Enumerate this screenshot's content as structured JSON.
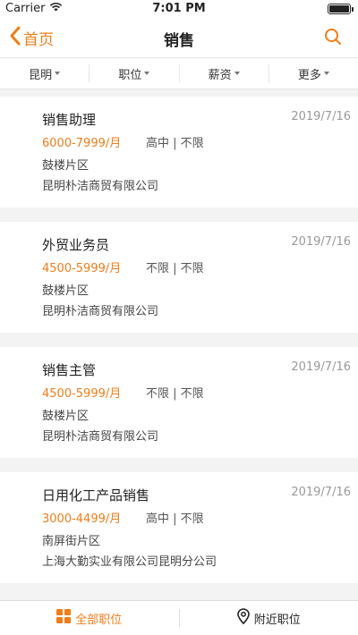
{
  "status": {
    "carrier": "Carrier",
    "time": "7:01 PM"
  },
  "nav": {
    "back_label": "首页",
    "title": "销售"
  },
  "filters": [
    {
      "label": "昆明"
    },
    {
      "label": "职位"
    },
    {
      "label": "薪资"
    },
    {
      "label": "更多"
    }
  ],
  "jobs": [
    {
      "title": "销售助理",
      "date": "2019/7/16",
      "salary": "6000-7999/月",
      "requirement": "高中 | 不限",
      "area": "鼓楼片区",
      "company": "昆明朴洁商贸有限公司"
    },
    {
      "title": "外贸业务员",
      "date": "2019/7/16",
      "salary": "4500-5999/月",
      "requirement": "不限 | 不限",
      "area": "鼓楼片区",
      "company": "昆明朴洁商贸有限公司"
    },
    {
      "title": "销售主管",
      "date": "2019/7/16",
      "salary": "4500-5999/月",
      "requirement": "不限 | 不限",
      "area": "鼓楼片区",
      "company": "昆明朴洁商贸有限公司"
    },
    {
      "title": "日用化工产品销售",
      "date": "2019/7/16",
      "salary": "3000-4499/月",
      "requirement": "高中 | 不限",
      "area": "南屏街片区",
      "company": "上海大勤实业有限公司昆明分公司"
    }
  ],
  "tabs": {
    "all_label": "全部职位",
    "nearby_label": "附近职位"
  },
  "colors": {
    "accent": "#f07d1a",
    "background": "#f3f3f3"
  },
  "icons": {
    "back": "chevron-left-icon",
    "search": "search-icon",
    "all": "grid-icon",
    "nearby": "location-pin-icon"
  }
}
